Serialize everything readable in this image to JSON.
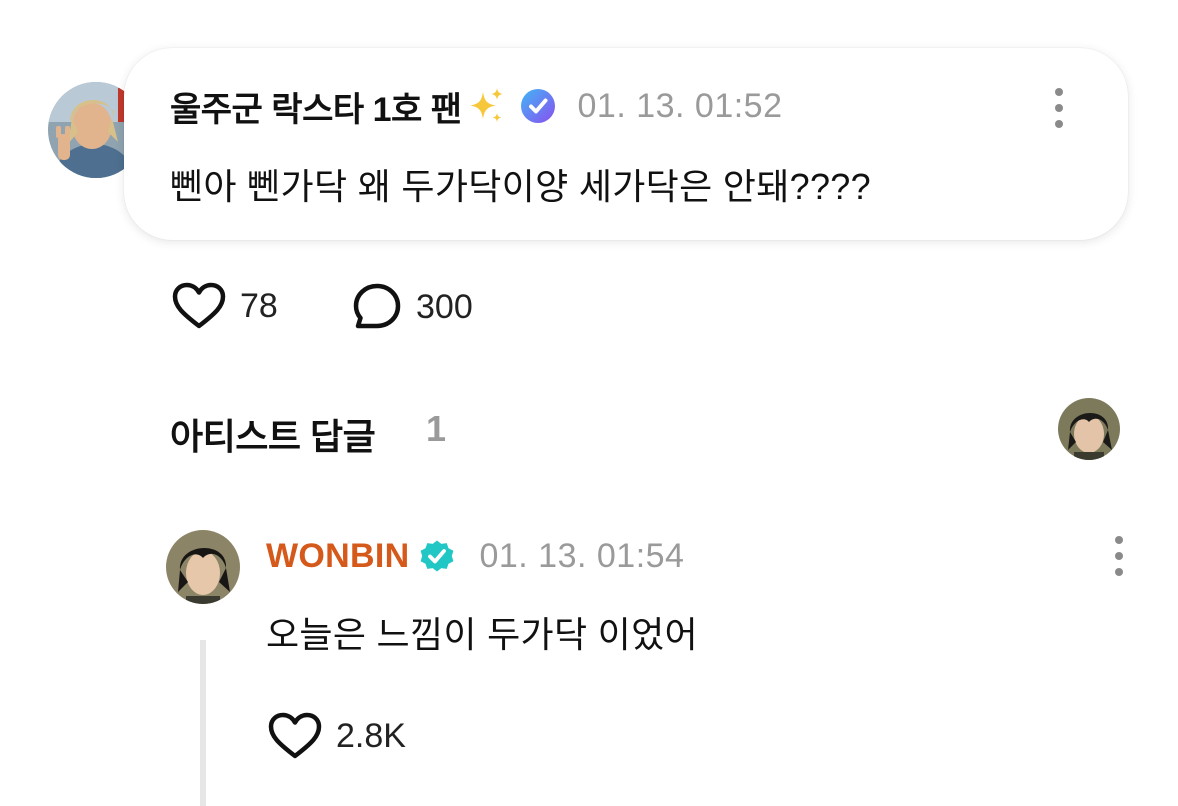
{
  "comment": {
    "author": "울주군 락스타 1호 팬",
    "timestamp": "01. 13. 01:52",
    "text": "뻰아 뻰가닥 왜 두가닥이양 세가닥은 안돼????",
    "likes": "78",
    "replies": "300",
    "icons": [
      "sparkles-icon",
      "verified-badge-icon",
      "more-options-icon",
      "heart-icon",
      "comment-bubble-icon"
    ]
  },
  "artist_replies": {
    "title": "아티스트 답글",
    "count": "1"
  },
  "reply": {
    "author": "WONBIN",
    "timestamp": "01. 13. 01:54",
    "text": "오늘은 느낌이 두가닥 이었어",
    "likes": "2.8K",
    "author_color": "#d4591a",
    "badge_color": "#21c7c5"
  }
}
